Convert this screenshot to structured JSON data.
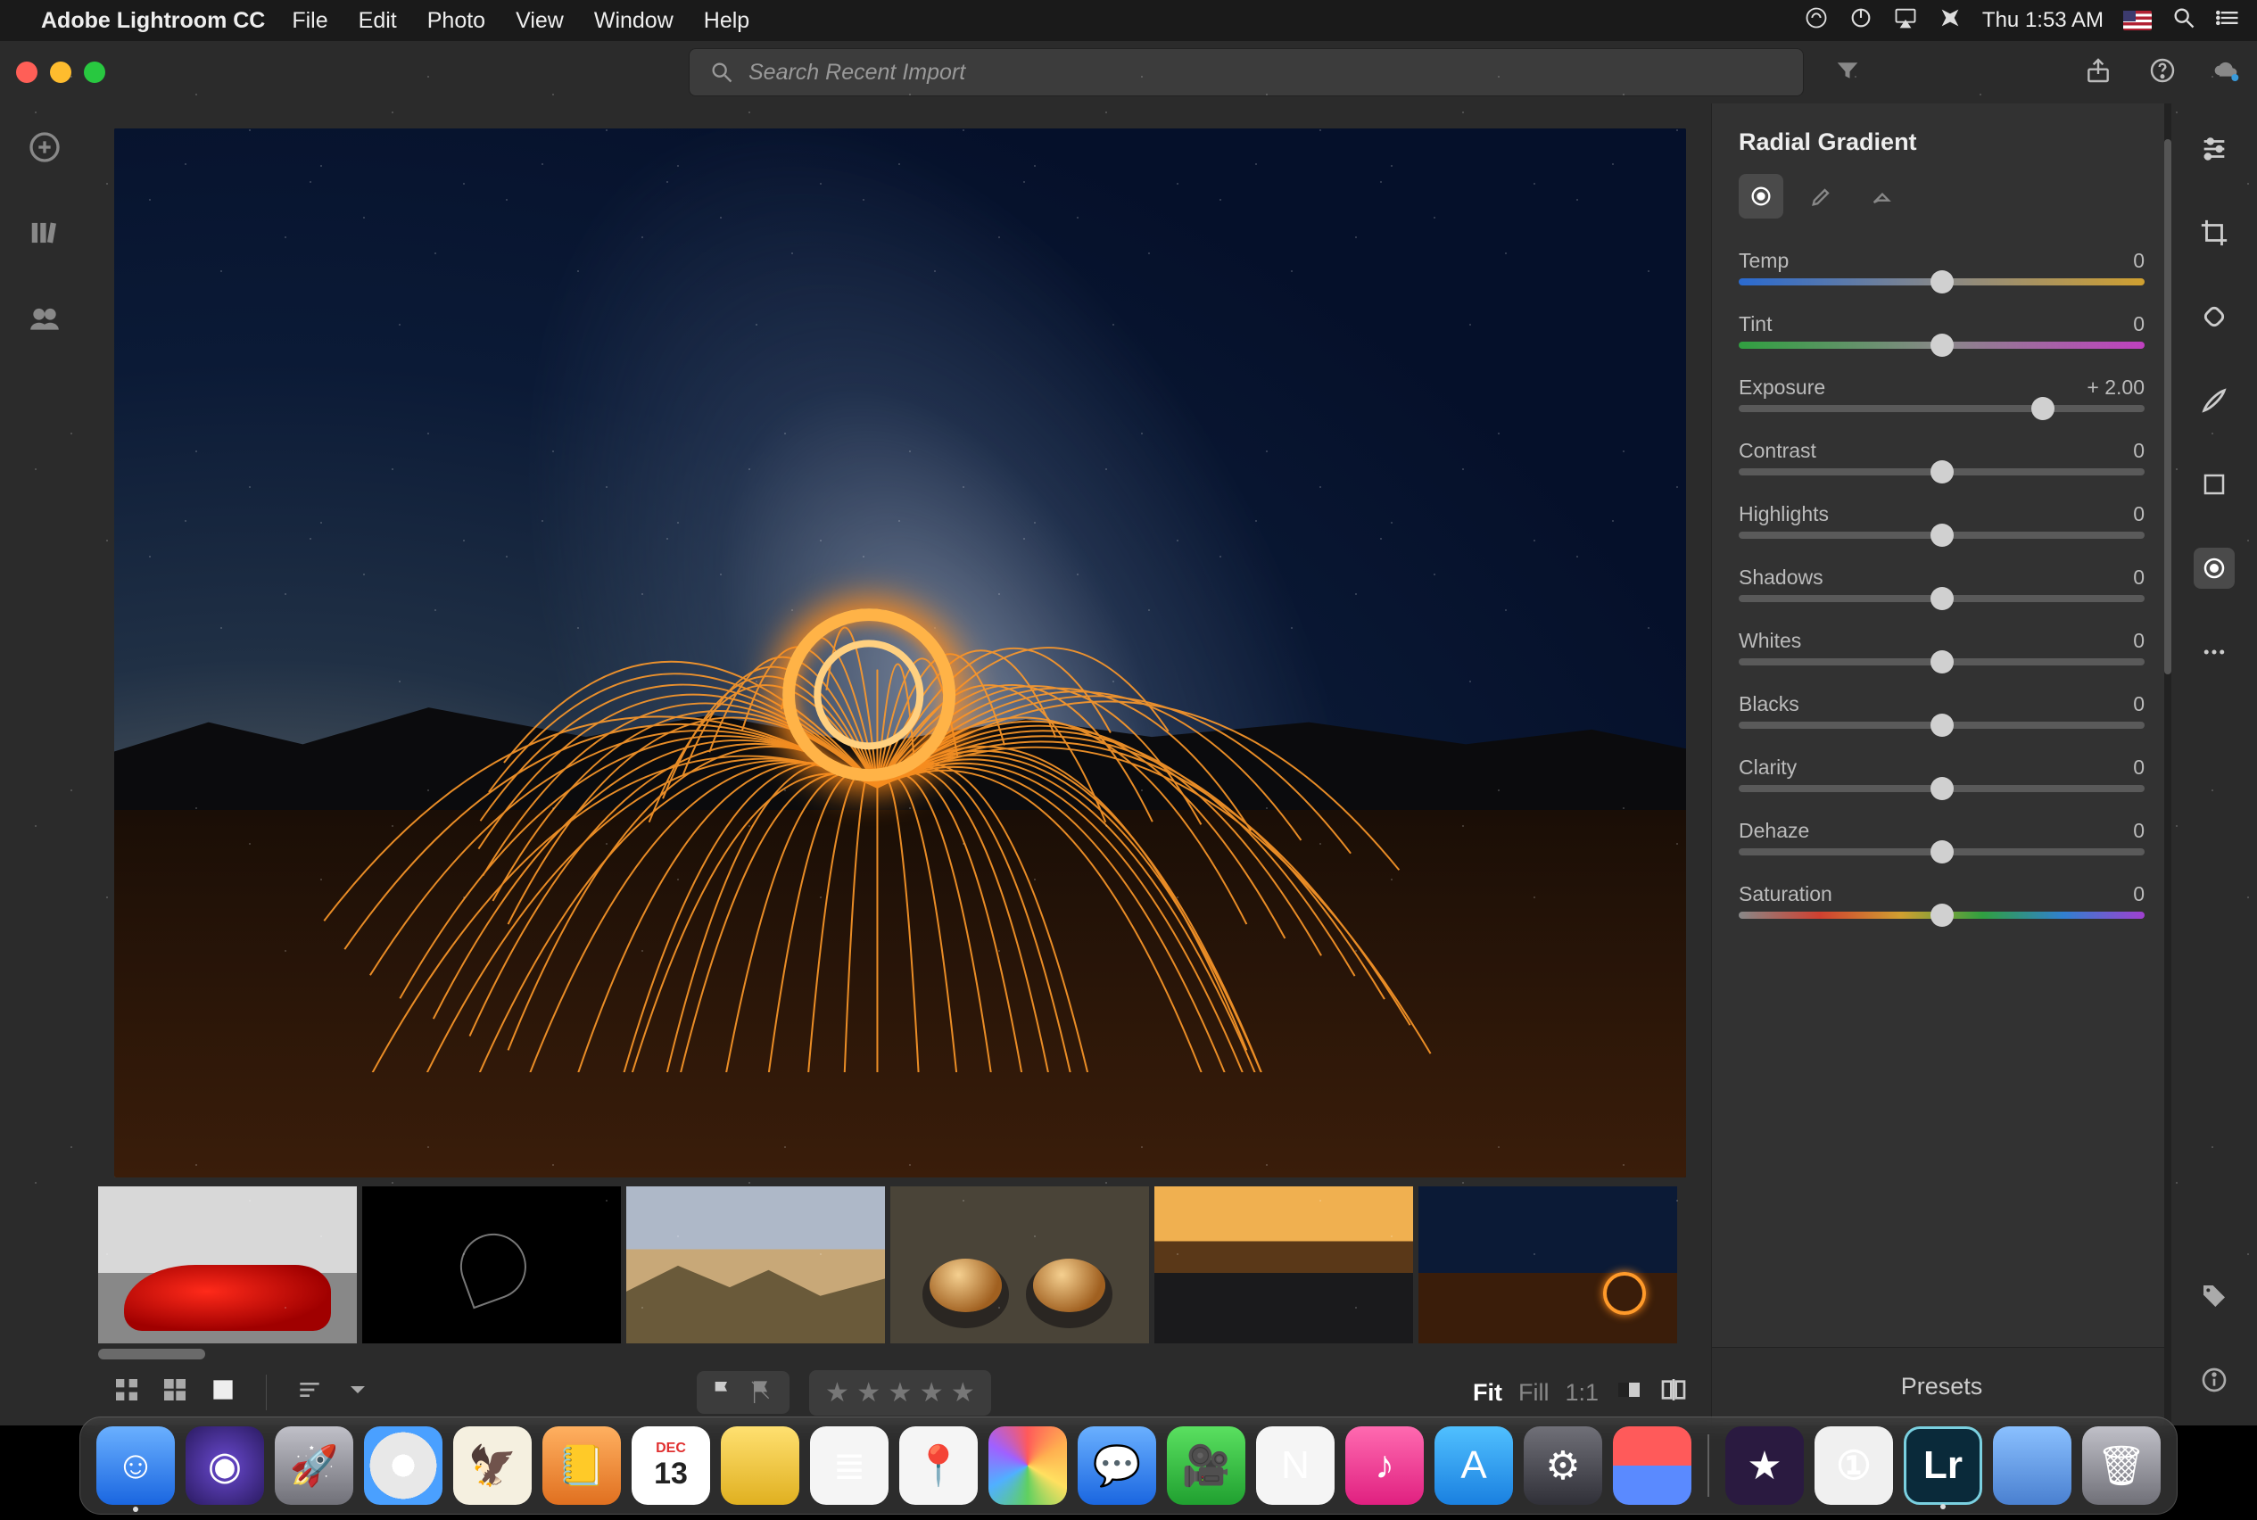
{
  "menubar": {
    "app_name": "Adobe Lightroom CC",
    "items": [
      "File",
      "Edit",
      "Photo",
      "View",
      "Window",
      "Help"
    ],
    "clock": "Thu 1:53 AM"
  },
  "titlebar": {
    "search_placeholder": "Search Recent Import"
  },
  "bottombar": {
    "zoom_fit": "Fit",
    "zoom_fill": "Fill",
    "zoom_1to1": "1:1"
  },
  "right_panel": {
    "title": "Radial Gradient",
    "sliders": [
      {
        "key": "temp",
        "label": "Temp",
        "value_text": "0",
        "pos": 50,
        "track": "temp"
      },
      {
        "key": "tint",
        "label": "Tint",
        "value_text": "0",
        "pos": 50,
        "track": "tint"
      },
      {
        "key": "exposure",
        "label": "Exposure",
        "value_text": "+ 2.00",
        "pos": 75,
        "track": "plain"
      },
      {
        "key": "contrast",
        "label": "Contrast",
        "value_text": "0",
        "pos": 50,
        "track": "plain"
      },
      {
        "key": "highlights",
        "label": "Highlights",
        "value_text": "0",
        "pos": 50,
        "track": "plain"
      },
      {
        "key": "shadows",
        "label": "Shadows",
        "value_text": "0",
        "pos": 50,
        "track": "plain"
      },
      {
        "key": "whites",
        "label": "Whites",
        "value_text": "0",
        "pos": 50,
        "track": "plain"
      },
      {
        "key": "blacks",
        "label": "Blacks",
        "value_text": "0",
        "pos": 50,
        "track": "plain"
      },
      {
        "key": "clarity",
        "label": "Clarity",
        "value_text": "0",
        "pos": 50,
        "track": "plain"
      },
      {
        "key": "dehaze",
        "label": "Dehaze",
        "value_text": "0",
        "pos": 50,
        "track": "plain"
      },
      {
        "key": "saturation",
        "label": "Saturation",
        "value_text": "0",
        "pos": 50,
        "track": "sat"
      }
    ],
    "presets_label": "Presets"
  },
  "filmstrip": {
    "thumbs": [
      {
        "name": "thumb-red-car",
        "cls": "t-car",
        "selected": false
      },
      {
        "name": "thumb-apple-outline",
        "cls": "t-apple",
        "selected": false
      },
      {
        "name": "thumb-mountains",
        "cls": "t-mtn",
        "selected": false
      },
      {
        "name": "thumb-coffee",
        "cls": "t-coffee",
        "selected": false
      },
      {
        "name": "thumb-seascape",
        "cls": "t-sea",
        "selected": false
      },
      {
        "name": "thumb-steelwool",
        "cls": "t-spark",
        "selected": true
      }
    ]
  },
  "dock": {
    "apps": [
      {
        "name": "finder",
        "cls": "grad-blue",
        "glyph": "☺",
        "running": true
      },
      {
        "name": "siri",
        "cls": "grad-purple",
        "glyph": "◉"
      },
      {
        "name": "launchpad",
        "cls": "grad-grey",
        "glyph": "🚀"
      },
      {
        "name": "safari",
        "cls": "grad-safari",
        "glyph": ""
      },
      {
        "name": "mail",
        "cls": "grad-stamp",
        "glyph": "🦅"
      },
      {
        "name": "contacts",
        "cls": "grad-orange",
        "glyph": "📒"
      },
      {
        "name": "calendar",
        "cls": "grad-cal",
        "glyph": "",
        "cal_top": "DEC",
        "cal_day": "13"
      },
      {
        "name": "notes",
        "cls": "grad-yellow",
        "glyph": ""
      },
      {
        "name": "reminders",
        "cls": "grad-white",
        "glyph": "≣"
      },
      {
        "name": "maps",
        "cls": "grad-white",
        "glyph": "📍"
      },
      {
        "name": "photos",
        "cls": "grad-photos",
        "glyph": ""
      },
      {
        "name": "messages",
        "cls": "grad-blue",
        "glyph": "💬"
      },
      {
        "name": "facetime",
        "cls": "grad-green",
        "glyph": "🎥"
      },
      {
        "name": "news",
        "cls": "grad-white",
        "glyph": "N"
      },
      {
        "name": "itunes",
        "cls": "grad-pink",
        "glyph": "♪"
      },
      {
        "name": "appstore",
        "cls": "grad-store",
        "glyph": "A"
      },
      {
        "name": "settings",
        "cls": "grad-dark",
        "glyph": "⚙"
      },
      {
        "name": "magnet",
        "cls": "grad-magnet",
        "glyph": ""
      }
    ],
    "apps_after_sep": [
      {
        "name": "imovie",
        "cls": "grad-imovie",
        "glyph": "★"
      },
      {
        "name": "1password",
        "cls": "grad-1p",
        "glyph": "①"
      },
      {
        "name": "lightroom",
        "cls": "grad-lr",
        "glyph": "Lr",
        "running": true
      },
      {
        "name": "downloads",
        "cls": "grad-folder",
        "glyph": ""
      },
      {
        "name": "trash",
        "cls": "grad-trash",
        "glyph": "🗑"
      }
    ]
  }
}
